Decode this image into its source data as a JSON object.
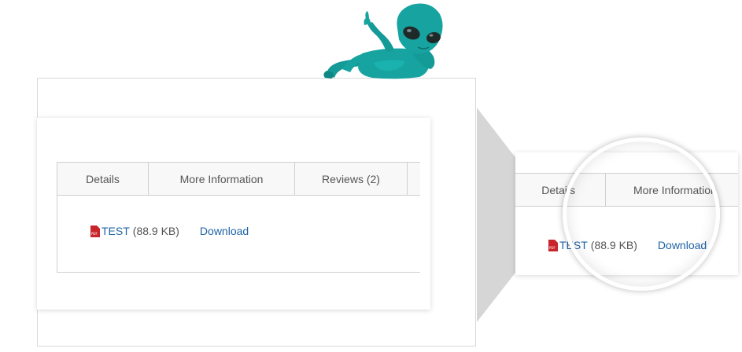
{
  "product_tabs": {
    "tabs": [
      {
        "label": "Details"
      },
      {
        "label": "More Information"
      },
      {
        "label": "Reviews (2)"
      }
    ],
    "attachment": {
      "file_icon": "pdf-icon",
      "file_name": "TEST",
      "file_size": "(88.9 KB)",
      "download_label": "Download"
    }
  },
  "zoom_view": {
    "tabs": [
      {
        "label": "Details"
      },
      {
        "label": "More Information"
      }
    ],
    "attachment": {
      "file_icon": "pdf-icon",
      "file_name": "TEST",
      "file_size": "(88.9 KB)",
      "download_label": "Download"
    }
  },
  "colors": {
    "link": "#1f63a6",
    "pdf_icon": "#c8242b",
    "mascot": "#17a3a0",
    "arrow": "#d6d6d6"
  }
}
